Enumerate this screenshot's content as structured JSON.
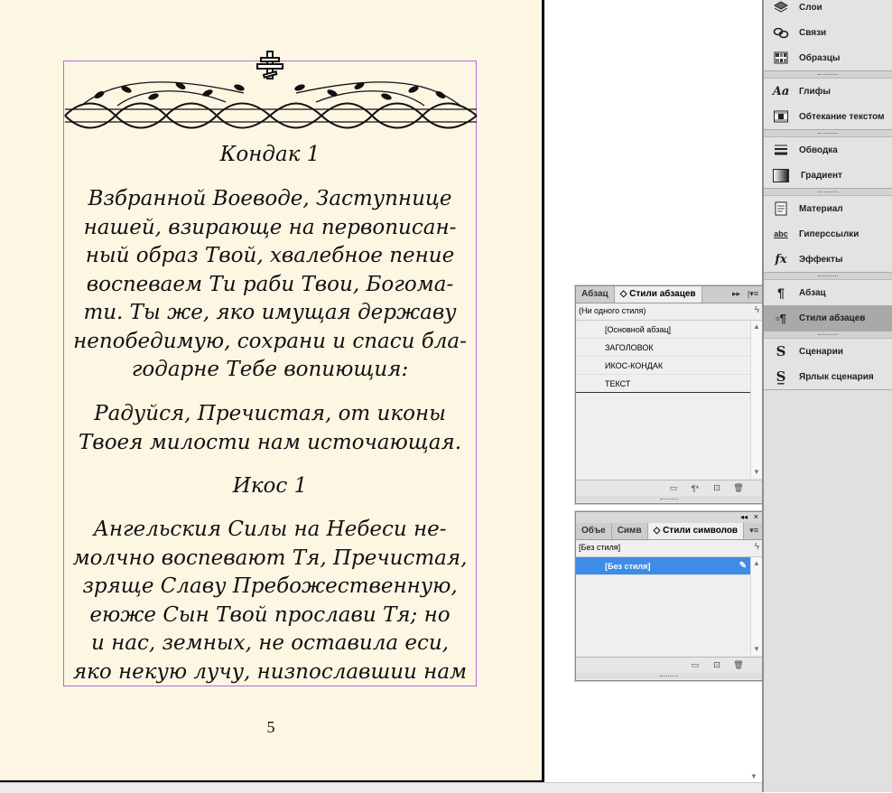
{
  "document": {
    "kondak_title": "Кондак 1",
    "kondak_body": "Взбранной Воеводе, Заступнице\nнашей, взирающе на первописан-\nный образ Твой, хвалебное пение\nвоспеваем Ти раби Твои, Богома-\nти. Ты же, яко имущая державу\nнепобедимую, сохрани и спаси бла-\nгодарне Тебе вопиющия:",
    "refrain": "Радуйся, Пречистая, от иконы\nТвоея милости нам источающая.",
    "ikos_title": "Икос 1",
    "ikos_body": "Ангельския Силы на Небеси не-\nмолчно воспевают Тя, Пречистая,\nзряще Славу Пребожественную,\nеюже Сын Твой прослави Тя; но\nи нас, земных, не оставила еси,\nяко некую лучу, низпославшии нам",
    "page_number": "5",
    "frame_color": "#b06cd6",
    "page_color": "#fcf6e3"
  },
  "dock": {
    "groups": [
      {
        "items": [
          {
            "label": "Слои",
            "icon": "layers-icon"
          },
          {
            "label": "Связи",
            "icon": "links-icon"
          },
          {
            "label": "Образцы",
            "icon": "swatches-icon"
          }
        ]
      },
      {
        "items": [
          {
            "label": "Глифы",
            "icon": "glyphs-icon"
          },
          {
            "label": "Обтекание текстом",
            "icon": "text-wrap-icon"
          }
        ]
      },
      {
        "items": [
          {
            "label": "Обводка",
            "icon": "stroke-icon"
          },
          {
            "label": "Градиент",
            "icon": "gradient-icon"
          }
        ]
      },
      {
        "items": [
          {
            "label": "Материал",
            "icon": "story-icon"
          },
          {
            "label": "Гиперссылки",
            "icon": "hyperlinks-icon"
          },
          {
            "label": "Эффекты",
            "icon": "effects-icon"
          }
        ]
      },
      {
        "items": [
          {
            "label": "Абзац",
            "icon": "paragraph-icon"
          },
          {
            "label": "Стили абзацев",
            "icon": "paragraph-styles-icon",
            "active": true
          }
        ]
      },
      {
        "items": [
          {
            "label": "Сценарии",
            "icon": "scripts-icon"
          },
          {
            "label": "Ярлык сценария",
            "icon": "script-label-icon"
          }
        ]
      }
    ]
  },
  "paragraph_panel": {
    "tabs": [
      "Абзац",
      "Стили абзацев"
    ],
    "active_tab": "Стили абзацев",
    "current_style": "(Ни одного стиля)",
    "styles": [
      "[Основной абзац]",
      "ЗАГОЛОВОК",
      "ИКОС-КОНДАК",
      "ТЕКСТ"
    ]
  },
  "character_panel": {
    "tabs": [
      "Объе",
      "Симв",
      "Стили символов"
    ],
    "active_tab": "Стили символов",
    "current_style": "[Без стиля]",
    "styles": [
      {
        "label": "[Без стиля]",
        "selected": true
      }
    ]
  },
  "colors": {
    "selection": "#3d8ce8",
    "dock_bg": "#e0e0e0",
    "active_item": "#a9a9a9"
  }
}
